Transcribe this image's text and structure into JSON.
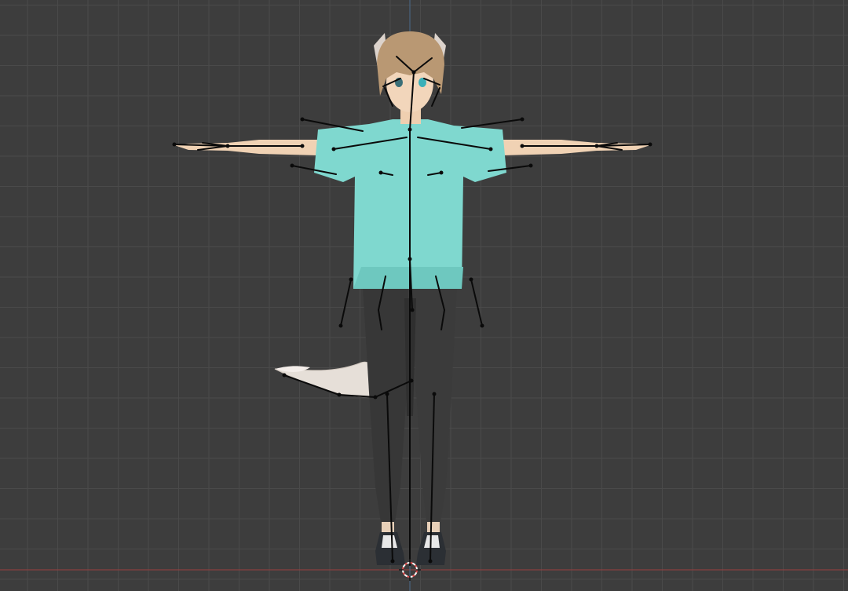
{
  "app": "3D viewport",
  "view": "front-orthographic",
  "colors": {
    "background": "#3d3d3d",
    "grid": "#4a4a4a",
    "x_axis": "#8a4040",
    "z_axis": "#4a6a8a",
    "shirt": "#7fd8cf",
    "pants": "#3a3a3a",
    "skin": "#f0d2b4",
    "hair": "#b99873",
    "tail": "#e6dfd8",
    "bones": "#0a0a0a"
  },
  "objects": [
    {
      "name": "character-mesh",
      "label": ""
    },
    {
      "name": "armature",
      "label": ""
    },
    {
      "name": "3d-cursor",
      "label": ""
    }
  ]
}
